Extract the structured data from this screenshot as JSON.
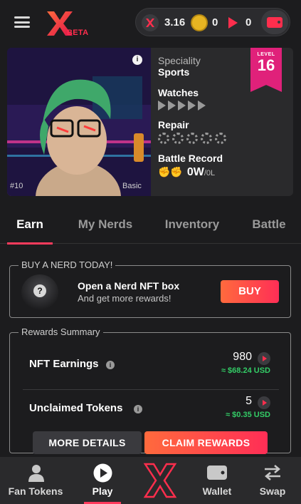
{
  "header": {
    "beta_label": "BETA",
    "balances": {
      "x_value": "3.16",
      "coin_value": "0",
      "play_value": "0"
    }
  },
  "nft_card": {
    "overlay_text": "Basic",
    "overlay_number": "#10",
    "speciality_label": "Speciality",
    "speciality_value": "Sports",
    "watches_label": "Watches",
    "watches_count": 5,
    "repair_label": "Repair",
    "repair_count": 5,
    "battle_label": "Battle Record",
    "battle_wins": "0W",
    "battle_losses": "/0L",
    "level_label": "LEVEL",
    "level_value": "16"
  },
  "tabs": [
    {
      "label": "Earn",
      "active": true
    },
    {
      "label": "My Nerds",
      "active": false
    },
    {
      "label": "Inventory",
      "active": false
    },
    {
      "label": "Battle",
      "active": false
    }
  ],
  "buy": {
    "legend": "BUY A NERD TODAY!",
    "title": "Open a Nerd NFT box",
    "subtitle": "And get more rewards!",
    "button": "BUY"
  },
  "rewards": {
    "legend": "Rewards Summary",
    "rows": [
      {
        "label": "NFT Earnings",
        "value": "980",
        "usd": "≈ $68.24 USD"
      },
      {
        "label": "Unclaimed Tokens",
        "value": "5",
        "usd": "≈ $0.35 USD"
      }
    ],
    "more_details": "MORE DETAILS",
    "claim": "CLAIM REWARDS"
  },
  "bottom_nav": [
    {
      "label": "Fan Tokens",
      "icon": "person-icon",
      "active": false
    },
    {
      "label": "Play",
      "icon": "play-circle-icon",
      "active": true
    },
    {
      "label": "",
      "icon": "x-logo-icon",
      "active": false
    },
    {
      "label": "Wallet",
      "icon": "wallet-icon",
      "active": false
    },
    {
      "label": "Swap",
      "icon": "swap-arrows-icon",
      "active": false
    }
  ],
  "colors": {
    "accent": "#ff2e4d",
    "level_badge": "#e0217a",
    "usd_green": "#33cc66",
    "background": "#1c1c1e"
  }
}
